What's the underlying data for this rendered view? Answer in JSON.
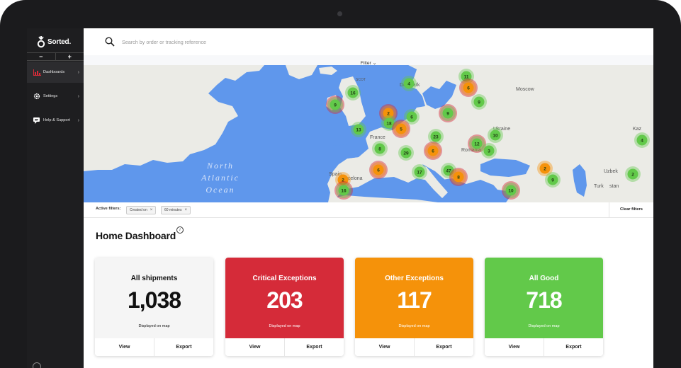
{
  "colors": {
    "sidebar_bg": "#1e1e20",
    "sea": "#5f97ec",
    "land": "#ebebe6",
    "green": "#62c94a",
    "orange": "#f5920a",
    "red": "#d52b39",
    "grey_card": "#f5f5f5"
  },
  "brand": {
    "name": "Sorted."
  },
  "sidebar": {
    "zoom_out": "−",
    "zoom_in": "+",
    "items": [
      {
        "label": "Dashboards",
        "icon": "bar-chart-icon",
        "chevron": "›"
      },
      {
        "label": "Settings",
        "icon": "gear-icon",
        "chevron": "›"
      },
      {
        "label": "Help & Support",
        "icon": "chat-icon",
        "chevron": "›"
      }
    ]
  },
  "search": {
    "placeholder": "Search by order or tracking reference",
    "value": ""
  },
  "filter": {
    "label": "Filter ⌄"
  },
  "map": {
    "ocean_label": [
      "North",
      "Atlantic",
      "Ocean"
    ],
    "labels": [
      "SCOT",
      "Denmark",
      "Moscow",
      "France",
      "Romania",
      "Ukraine",
      "Kaz",
      "Uzbek",
      "Turk",
      "stan",
      "Spain",
      "Barcelona"
    ],
    "clusters": [
      {
        "count": "11",
        "status": "green"
      },
      {
        "count": "4",
        "status": "green"
      },
      {
        "count": "6",
        "status": "orange"
      },
      {
        "count": "16",
        "status": "green"
      },
      {
        "count": "9",
        "status": "green"
      },
      {
        "count": "9",
        "status": "green"
      },
      {
        "count": "2",
        "status": "orange"
      },
      {
        "count": "18",
        "status": "green"
      },
      {
        "count": "6",
        "status": "green"
      },
      {
        "count": "9",
        "status": "green"
      },
      {
        "count": "13",
        "status": "green"
      },
      {
        "count": "5",
        "status": "orange"
      },
      {
        "count": "23",
        "status": "green"
      },
      {
        "count": "10",
        "status": "green"
      },
      {
        "count": "4",
        "status": "green"
      },
      {
        "count": "8",
        "status": "green"
      },
      {
        "count": "29",
        "status": "green"
      },
      {
        "count": "6",
        "status": "orange"
      },
      {
        "count": "12",
        "status": "green"
      },
      {
        "count": "3",
        "status": "green"
      },
      {
        "count": "6",
        "status": "orange"
      },
      {
        "count": "17",
        "status": "green"
      },
      {
        "count": "47",
        "status": "green"
      },
      {
        "count": "8",
        "status": "orange"
      },
      {
        "count": "2",
        "status": "orange"
      },
      {
        "count": "2",
        "status": "green"
      },
      {
        "count": "2",
        "status": "orange"
      },
      {
        "count": "16",
        "status": "green"
      },
      {
        "count": "10",
        "status": "green"
      },
      {
        "count": "9",
        "status": "green"
      }
    ]
  },
  "active_filters": {
    "label": "Active filters:",
    "chips": [
      "Created on",
      "60 minutes"
    ],
    "clear": "Clear filters"
  },
  "dashboard": {
    "title": "Home Dashboard",
    "info": "i",
    "cards": [
      {
        "title": "All shipments",
        "count": "1,038",
        "sub": "Displayed on map",
        "view": "View",
        "export": "Export"
      },
      {
        "title": "Critical Exceptions",
        "count": "203",
        "sub": "Displayed on map",
        "view": "View",
        "export": "Export"
      },
      {
        "title": "Other Exceptions",
        "count": "117",
        "sub": "Displayed on map",
        "view": "View",
        "export": "Export"
      },
      {
        "title": "All Good",
        "count": "718",
        "sub": "Displayed on map",
        "view": "View",
        "export": "Export"
      }
    ]
  }
}
